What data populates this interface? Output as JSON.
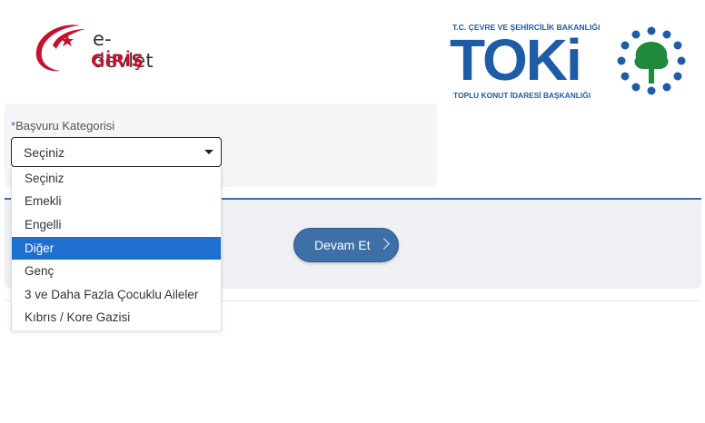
{
  "header": {
    "edevlet_logo": {
      "brand": "e-devlet",
      "giris": "GİRİŞ",
      "icon": "crescent-star-swoosh-icon"
    },
    "toki_logo": {
      "top_line": "T.C. ÇEVRE VE ŞEHİRCİLİK BAKANLIĞI",
      "word": "TOKi",
      "bottom_line": "TOPLU KONUT İDARESİ BAŞKANLIĞI",
      "icon": "tree-dots-emblem-icon"
    }
  },
  "form": {
    "required_marker": "*",
    "label": "Başvuru Kategorisi",
    "select_value": "Seçiniz",
    "options": [
      "Seçiniz",
      "Emekli",
      "Engelli",
      "Diğer",
      "Genç",
      "3 ve Daha Fazla Çocuklu Aileler",
      "Kıbrıs / Kore Gazisi"
    ],
    "highlighted_option": "Diğer"
  },
  "actions": {
    "continue_label": "Devam Et"
  },
  "colors": {
    "brand_blue": "#1f5ca8",
    "button_blue": "#3e6fa7",
    "highlight_blue": "#1e6fd0",
    "edevlet_red": "#c8102e"
  }
}
